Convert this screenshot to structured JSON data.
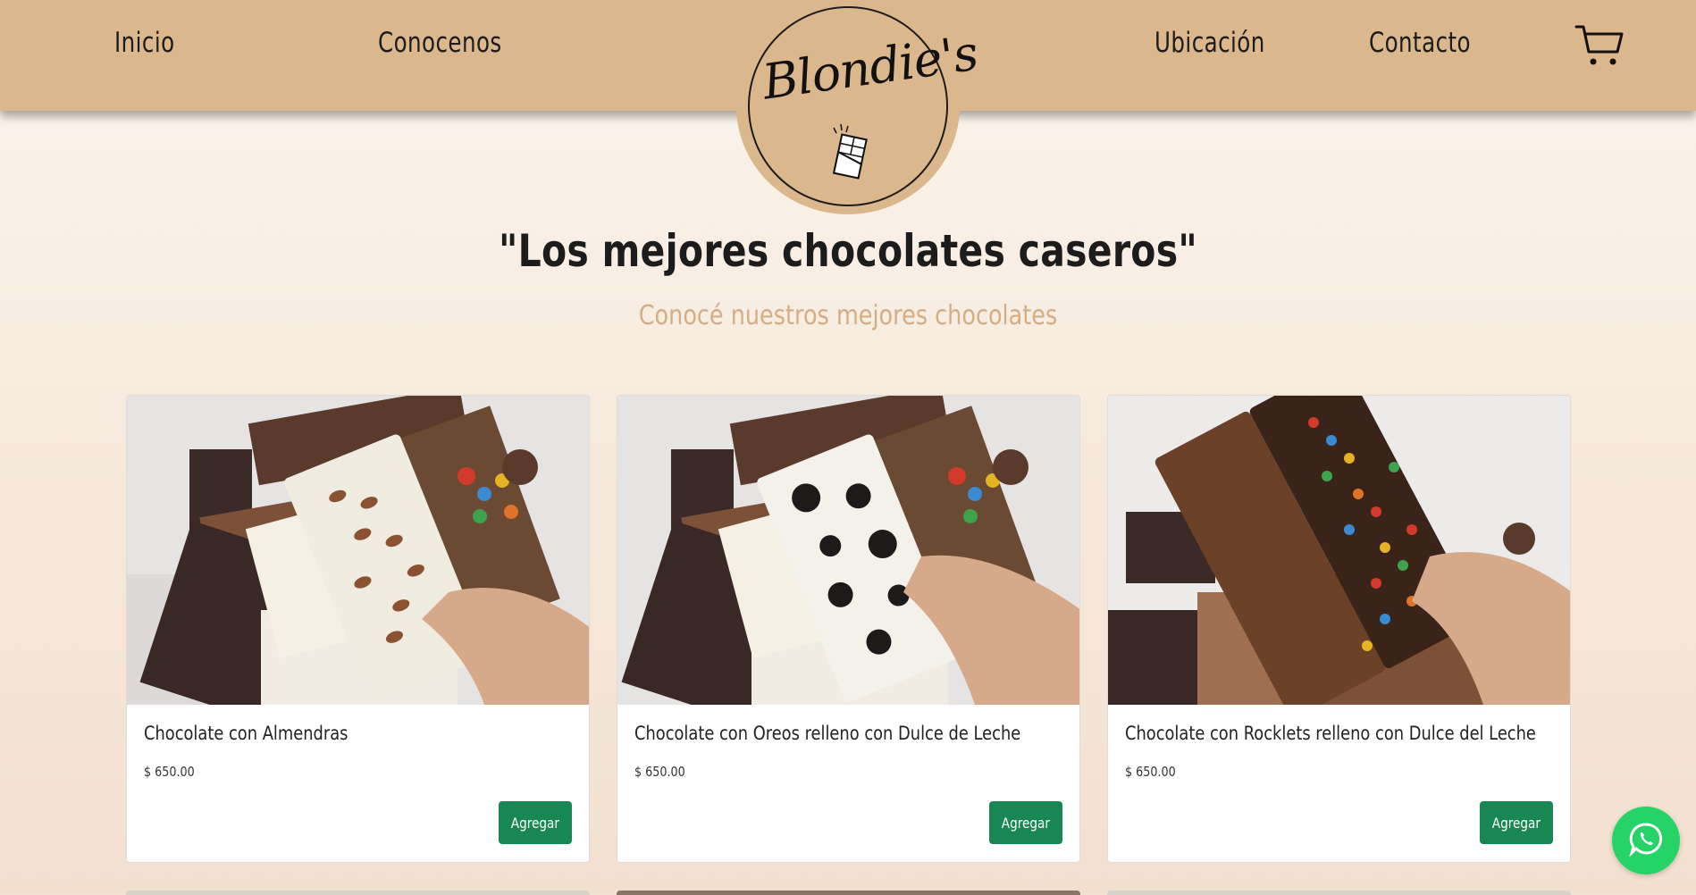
{
  "nav": {
    "links": [
      "Inicio",
      "Conocenos",
      "Ubicación",
      "Contacto"
    ],
    "cart_icon": "shopping-cart-icon"
  },
  "logo": {
    "text": "Blondie's",
    "icon": "chocolate-bar-icon"
  },
  "hero": {
    "title": "\"Los mejores chocolates caseros\"",
    "subtitle": "Conocé nuestros mejores chocolates"
  },
  "products": [
    {
      "name": "Chocolate con Almendras",
      "price": "$ 650.00",
      "button": "Agregar",
      "topping": "almonds"
    },
    {
      "name": "Chocolate con Oreos relleno con Dulce de Leche",
      "price": "$ 650.00",
      "button": "Agregar",
      "topping": "oreos"
    },
    {
      "name": "Chocolate con Rocklets relleno con Dulce del Leche",
      "price": "$ 650.00",
      "button": "Agregar",
      "topping": "rocklets"
    }
  ],
  "colors": {
    "nav_bg": "#dbb78d",
    "accent_subtitle": "#d5ad83",
    "button_green": "#198754",
    "whatsapp_green": "#25d366"
  },
  "floating": {
    "icon": "whatsapp-icon"
  }
}
